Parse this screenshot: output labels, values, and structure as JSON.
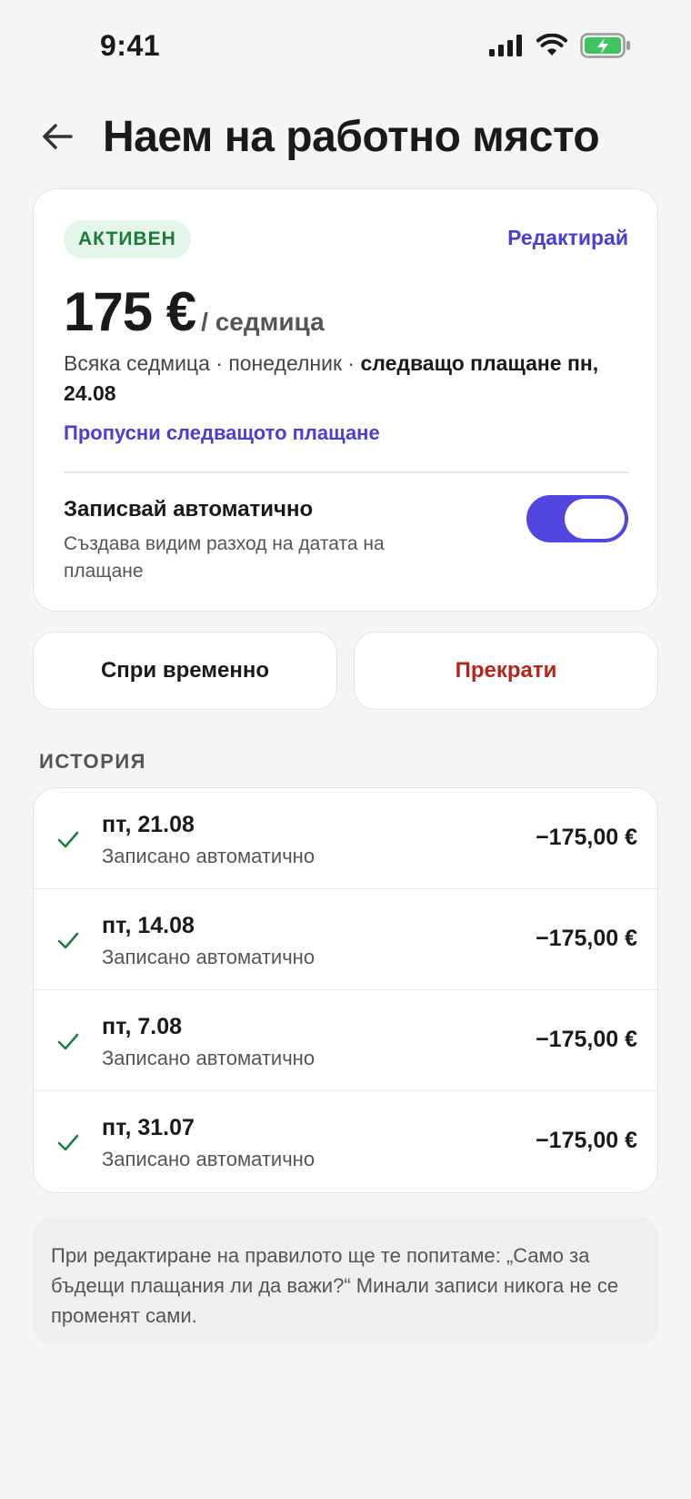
{
  "status_bar": {
    "time": "9:41"
  },
  "header": {
    "title": "Наем на работно място"
  },
  "rule": {
    "badge": "АКТИВЕН",
    "edit_label": "Редактирай",
    "amount": "175 €",
    "period": "/ седмица",
    "schedule_prefix": "Всяка седмица · понеделник · ",
    "schedule_next": "следващо плащане пн, 24.08",
    "skip_label": "Пропусни следващото плащане",
    "auto_title": "Записвай автоматично",
    "auto_subtitle": "Създава видим разход на датата на плащане",
    "auto_enabled": true
  },
  "actions": {
    "pause_label": "Спри временно",
    "stop_label": "Прекрати"
  },
  "history": {
    "label": "ИСТОРИЯ",
    "items": [
      {
        "date": "пт, 21.08",
        "note": "Записано автоматично",
        "amount": "−175,00 €"
      },
      {
        "date": "пт, 14.08",
        "note": "Записано автоматично",
        "amount": "−175,00 €"
      },
      {
        "date": "пт, 7.08",
        "note": "Записано автоматично",
        "amount": "−175,00 €"
      },
      {
        "date": "пт, 31.07",
        "note": "Записано автоматично",
        "amount": "−175,00 €"
      }
    ]
  },
  "info_text": "При редактиране на правилото ще те попитаме: „Само за бъдещи плащания ли да важи?“ Минали записи никога не се променят сами.",
  "colors": {
    "accent": "#5146e0",
    "link": "#4a3fcf",
    "success": "#1d7a3c",
    "danger": "#b3261e"
  }
}
